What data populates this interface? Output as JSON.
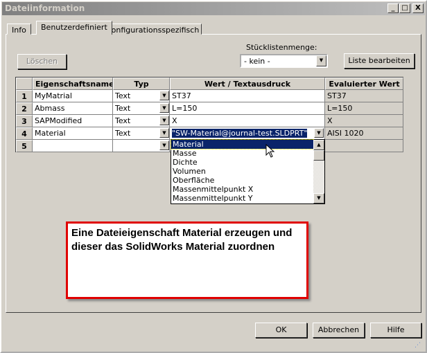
{
  "window": {
    "title": "Dateiinformation",
    "minimize": "_",
    "maximize": "□",
    "close": "X"
  },
  "tabs": [
    {
      "label": "Info"
    },
    {
      "label": "Benutzerdefiniert"
    },
    {
      "label": "Konfigurationsspezifisch"
    }
  ],
  "toolbar": {
    "delete_label": "Löschen",
    "bom_label": "Stücklistenmenge:",
    "bom_value": "- kein -",
    "edit_list_label": "Liste bearbeiten"
  },
  "table": {
    "headers": [
      "Eigenschaftsname",
      "Typ",
      "Wert / Textausdruck",
      "Evaluierter Wert"
    ],
    "rows": [
      {
        "num": "1",
        "name": "MyMatrial",
        "type": "Text",
        "value": "ST37",
        "evaluated": "ST37"
      },
      {
        "num": "2",
        "name": "Abmass",
        "type": "Text",
        "value": "L=150",
        "evaluated": "L=150"
      },
      {
        "num": "3",
        "name": "SAPModified",
        "type": "Text",
        "value": "X",
        "evaluated": "X"
      },
      {
        "num": "4",
        "name": "Material",
        "type": "Text",
        "value": "\"SW-Material@journal-test.SLDPRT\"",
        "evaluated": "AISI 1020"
      },
      {
        "num": "5",
        "name": "",
        "type": "",
        "value": "",
        "evaluated": ""
      }
    ]
  },
  "dropdown": {
    "items": [
      "Material",
      "Masse",
      "Dichte",
      "Volumen",
      "Oberfläche",
      "Massenmittelpunkt X",
      "Massenmittelpunkt Y"
    ],
    "selected": "Material"
  },
  "annotation": "Eine Dateieigenschaft Material erzeugen und dieser das SolidWorks Material zuordnen",
  "buttons": {
    "ok": "OK",
    "cancel": "Abbrechen",
    "help": "Hilfe"
  },
  "colors": {
    "selection": "#0a246a",
    "annotation_border": "#e00000"
  }
}
